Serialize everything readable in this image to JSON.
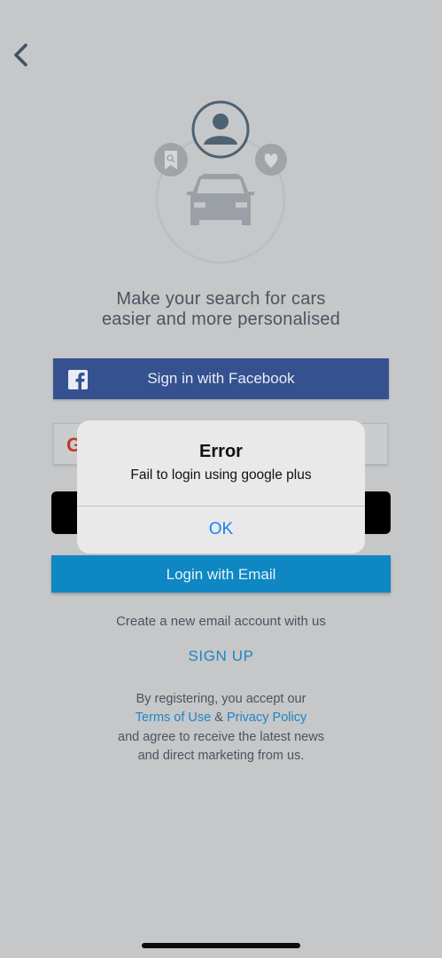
{
  "header": {
    "back_icon": "chevron-left-icon"
  },
  "hero": {
    "icons": [
      "user-icon",
      "bookmark-search-icon",
      "heart-icon",
      "car-icon"
    ],
    "tagline_line1": "Make your search for cars",
    "tagline_line2": "easier and more personalised"
  },
  "buttons": {
    "facebook_label": "Sign in with Facebook",
    "google_icon": "G",
    "email_label": "Login with Email"
  },
  "signup": {
    "prompt": "Create a new email account with us",
    "link": "SIGN UP"
  },
  "legal": {
    "line1": "By registering, you accept our",
    "terms": "Terms of Use",
    "amp": "&",
    "privacy": "Privacy Policy",
    "line3": "and agree to receive the latest news",
    "line4": "and direct marketing from us."
  },
  "alert": {
    "title": "Error",
    "message": "Fail to login using google plus",
    "ok_label": "OK"
  },
  "colors": {
    "facebook": "#36518f",
    "email": "#0e87c2",
    "link": "#1f86c4",
    "alert_ok": "#1a82f4"
  }
}
